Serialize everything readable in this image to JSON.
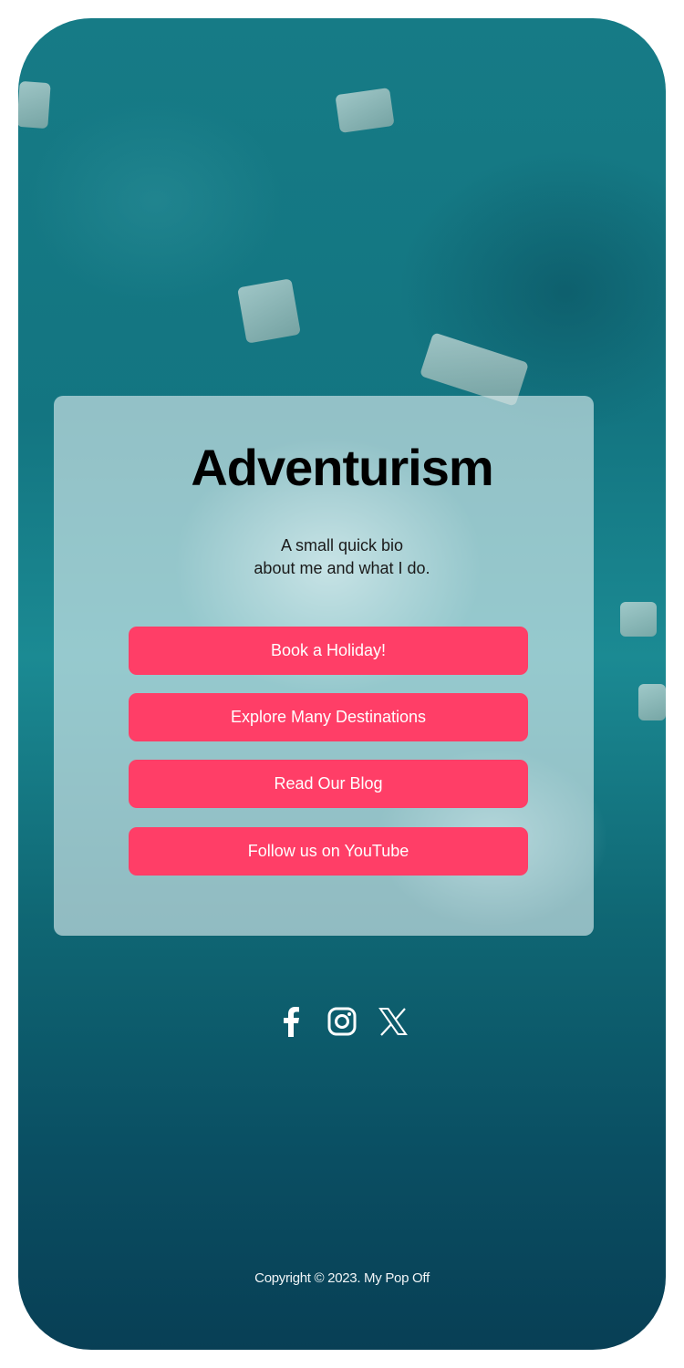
{
  "profile": {
    "title": "Adventurism",
    "bio_line1": "A small quick bio",
    "bio_line2": "about me and what I do."
  },
  "links": [
    {
      "label": "Book a Holiday!"
    },
    {
      "label": "Explore Many Destinations"
    },
    {
      "label": "Read Our Blog"
    },
    {
      "label": "Follow us on YouTube"
    }
  ],
  "socials": [
    {
      "icon": "facebook-icon"
    },
    {
      "icon": "instagram-icon"
    },
    {
      "icon": "x-twitter-icon"
    }
  ],
  "footer": {
    "copyright": "Copyright © 2023. My Pop Off"
  },
  "colors": {
    "button": "#ff3e67",
    "background": "#137581",
    "card": "#e2f0f2"
  }
}
